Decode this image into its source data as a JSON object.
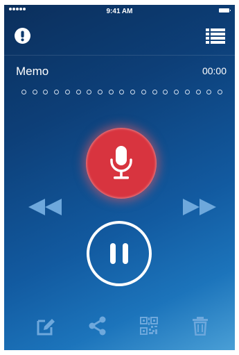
{
  "status_bar": {
    "time": "9:41 AM"
  },
  "nav": {
    "alert_icon": "exclamation-circle-icon",
    "menu_icon": "list-icon"
  },
  "memo": {
    "title": "Memo",
    "duration": "00:00",
    "position_markers": 19
  },
  "controls": {
    "record_icon": "microphone-icon",
    "rewind_icon": "rewind-icon",
    "forward_icon": "fast-forward-icon",
    "pause_icon": "pause-icon"
  },
  "toolbar": [
    "edit-icon",
    "share-icon",
    "qr-code-icon",
    "trash-icon"
  ],
  "colors": {
    "record": "#d8343f",
    "background_top": "#0b2f5c",
    "background_bottom": "#4a9fd6",
    "dim_icon": "#6ea8dc"
  }
}
